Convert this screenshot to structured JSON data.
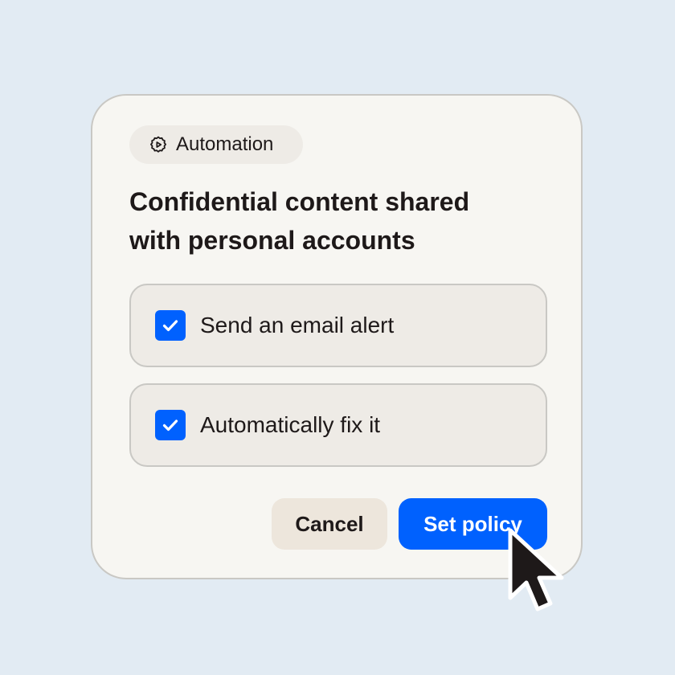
{
  "dialog": {
    "tag": {
      "icon": "gear-play-icon",
      "label": "Automation"
    },
    "title_line1": "Confidential content shared",
    "title_line2": "with personal accounts",
    "options": [
      {
        "label": "Send an email alert",
        "checked": true
      },
      {
        "label": "Automatically fix it",
        "checked": true
      }
    ],
    "buttons": {
      "cancel_label": "Cancel",
      "set_policy_label": "Set policy"
    }
  },
  "pointer": {
    "icon": "mouse-cursor-icon"
  },
  "colors": {
    "background": "#e2ebf3",
    "card": "#f7f6f2",
    "accent": "#0061fe",
    "text": "#1e1919",
    "cancel_bg": "#ede6dc"
  }
}
